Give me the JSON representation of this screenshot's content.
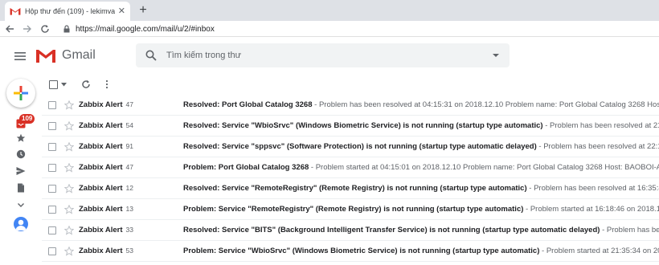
{
  "browser": {
    "tab_title": "Hộp thư đến (109) - lekimvanmi",
    "new_tab_symbol": "+",
    "url": "https://mail.google.com/mail/u/2/#inbox"
  },
  "gmail": {
    "product_name": "Gmail",
    "search_placeholder": "Tìm kiếm trong thư",
    "inbox_badge": "109"
  },
  "colors": {
    "brand_red": "#d93025",
    "compose_blue": "#4285f4",
    "compose_green": "#34a853",
    "compose_yellow": "#fbbc04"
  },
  "rail_icons": [
    "inbox-icon",
    "star-icon",
    "clock-icon",
    "send-icon",
    "draft-icon",
    "chevron-down-icon"
  ],
  "emails": [
    {
      "sender": "Zabbix Alert",
      "count": "47",
      "subject": "Resolved: Port Global Catalog 3268",
      "snippet": " - Problem has been resolved at 04:15:31 on 2018.12.10 Problem name: Port Global Catalog 3268 Host: BAO"
    },
    {
      "sender": "Zabbix Alert",
      "count": "54",
      "subject": "Resolved: Service \"WbioSrvc\" (Windows Biometric Service) is not running (startup type automatic)",
      "snippet": " - Problem has been resolved at 21:44:34 on"
    },
    {
      "sender": "Zabbix Alert",
      "count": "91",
      "subject": "Resolved: Service \"sppsvc\" (Software Protection) is not running (startup type automatic delayed)",
      "snippet": " - Problem has been resolved at 22:11:27 on"
    },
    {
      "sender": "Zabbix Alert",
      "count": "47",
      "subject": "Problem: Port Global Catalog 3268",
      "snippet": " - Problem started at 04:15:01 on 2018.12.10 Problem name: Port Global Catalog 3268 Host: BAOBOI-AD01 S"
    },
    {
      "sender": "Zabbix Alert",
      "count": "12",
      "subject": "Resolved: Service \"RemoteRegistry\" (Remote Registry) is not running (startup type automatic)",
      "snippet": " - Problem has been resolved at 16:35:46 on 2018"
    },
    {
      "sender": "Zabbix Alert",
      "count": "13",
      "subject": "Problem: Service \"RemoteRegistry\" (Remote Registry) is not running (startup type automatic)",
      "snippet": " - Problem started at 16:18:46 on 2018.12.10 P"
    },
    {
      "sender": "Zabbix Alert",
      "count": "33",
      "subject": "Resolved: Service \"BITS\" (Background Intelligent Transfer Service) is not running (startup type automatic delayed)",
      "snippet": " - Problem has been resolve"
    },
    {
      "sender": "Zabbix Alert",
      "count": "53",
      "subject": "Problem: Service \"WbioSrvc\" (Windows Biometric Service) is not running (startup type automatic)",
      "snippet": " - Problem started at 21:35:34 on 2018.12.09"
    }
  ]
}
